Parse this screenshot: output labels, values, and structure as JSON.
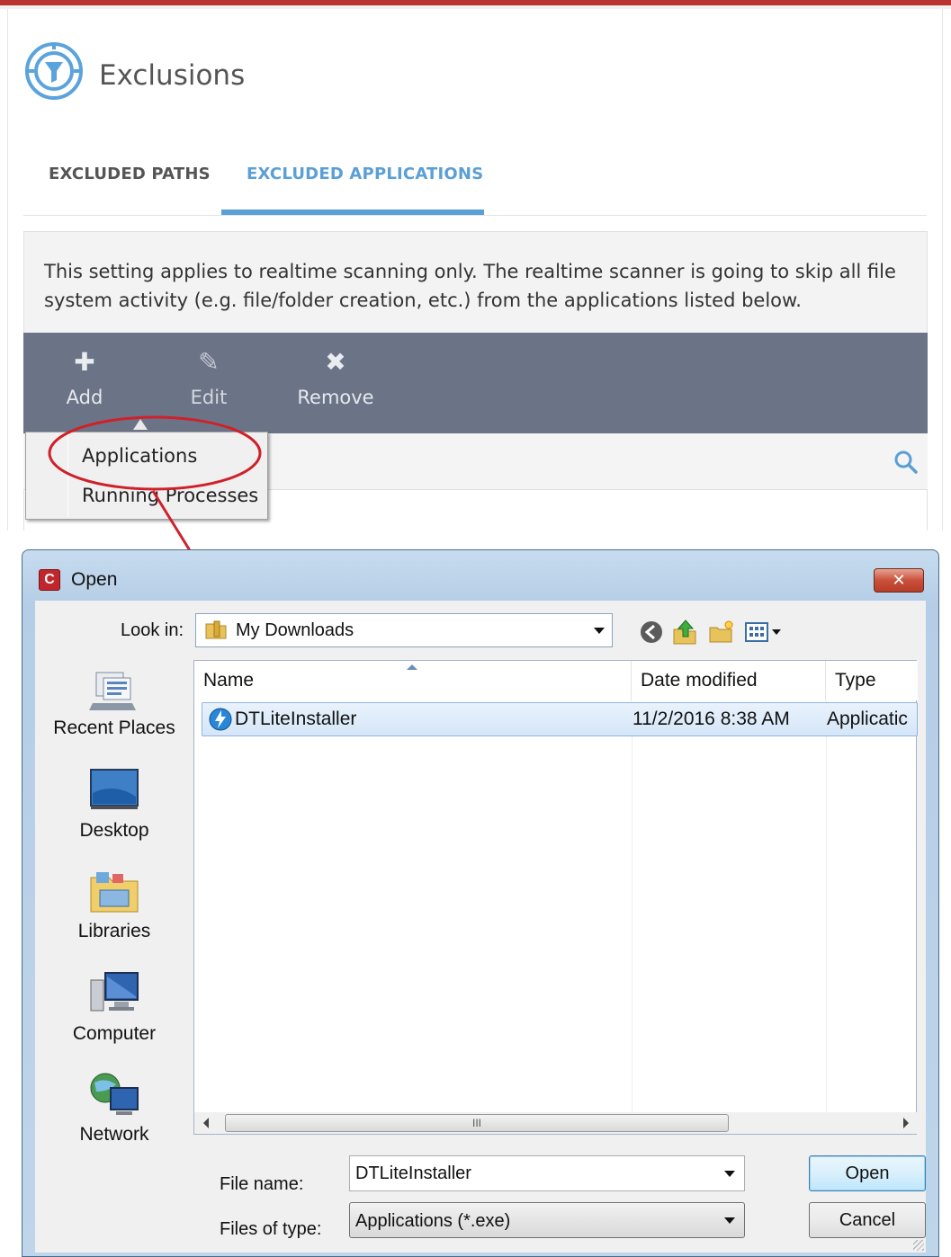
{
  "exclusions": {
    "title": "Exclusions",
    "tabs": [
      {
        "label": "EXCLUDED PATHS",
        "active": false
      },
      {
        "label": "EXCLUDED APPLICATIONS",
        "active": true
      }
    ],
    "info_text": "This setting applies to realtime scanning only. The realtime scanner is going to skip all file system activity (e.g. file/folder creation, etc.) from the applications listed below.",
    "toolbar": {
      "add_label": "Add",
      "edit_label": "Edit",
      "remove_label": "Remove"
    },
    "add_menu": {
      "items": [
        "Applications",
        "Running Processes"
      ]
    },
    "colors": {
      "accent": "#5a9fd6",
      "toolbar_bg": "#6b7486",
      "annotation": "#d0202a"
    }
  },
  "open_dialog": {
    "title": "Open",
    "close_glyph": "✕",
    "look_in_label": "Look in:",
    "look_in_value": "My Downloads",
    "places": [
      {
        "label": "Recent Places",
        "icon": "recent-places-icon"
      },
      {
        "label": "Desktop",
        "icon": "desktop-icon"
      },
      {
        "label": "Libraries",
        "icon": "libraries-icon"
      },
      {
        "label": "Computer",
        "icon": "computer-icon"
      },
      {
        "label": "Network",
        "icon": "network-icon"
      }
    ],
    "columns": {
      "name": "Name",
      "date": "Date modified",
      "type": "Type"
    },
    "files": [
      {
        "name": "DTLiteInstaller",
        "date": "11/2/2016 8:38 AM",
        "type": "Applicatic"
      }
    ],
    "scroll_grip": "III",
    "file_name_label": "File name:",
    "file_name_value": "DTLiteInstaller",
    "file_type_label": "Files of type:",
    "file_type_value": "Applications (*.exe)",
    "open_button": "Open",
    "cancel_button": "Cancel"
  }
}
